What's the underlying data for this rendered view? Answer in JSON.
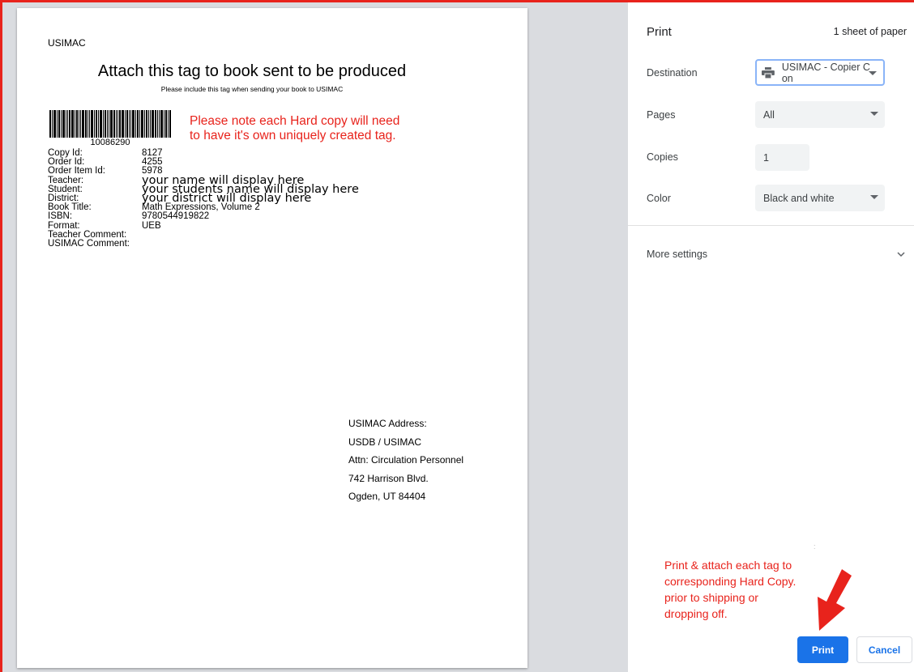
{
  "page": {
    "org": "USIMAC",
    "title": "Attach this tag to book sent to be produced",
    "subtitle": "Please include this tag when sending your book to USIMAC",
    "barcode_number": "10086290",
    "note_top_line1": "Please note each Hard copy will need",
    "note_top_line2": "to have it's own uniquely created tag.",
    "fields": [
      {
        "label": "Copy Id:",
        "value": "8127"
      },
      {
        "label": "Order Id:",
        "value": "4255"
      },
      {
        "label": "Order Item Id:",
        "value": "5978"
      },
      {
        "label": "Teacher:",
        "value": "your name will display here"
      },
      {
        "label": "Student:",
        "value": "your students name will display here"
      },
      {
        "label": "District:",
        "value": "your district will display here"
      },
      {
        "label": "Book Title:",
        "value": "Math Expressions, Volume 2"
      },
      {
        "label": "ISBN:",
        "value": "9780544919822"
      },
      {
        "label": "Format:",
        "value": "UEB"
      },
      {
        "label": "Teacher Comment:",
        "value": ""
      },
      {
        "label": "USIMAC Comment:",
        "value": ""
      }
    ],
    "address": [
      "USIMAC Address:",
      "USDB / USIMAC",
      "Attn: Circulation Personnel",
      "742 Harrison Blvd.",
      "Ogden, UT 84404"
    ]
  },
  "panel": {
    "title": "Print",
    "sheets": "1 sheet of paper",
    "destination_label": "Destination",
    "destination_value": "USIMAC - Copier C on",
    "pages_label": "Pages",
    "pages_value": "All",
    "copies_label": "Copies",
    "copies_value": "1",
    "color_label": "Color",
    "color_value": "Black and white",
    "more_settings": "More settings",
    "note_bottom": [
      "Print & attach each tag to",
      "corresponding Hard Copy.",
      "prior to shipping or",
      "dropping off."
    ],
    "print_button": "Print",
    "cancel_button": "Cancel"
  },
  "colors": {
    "annotation_red": "#e8231c",
    "primary_blue": "#1a73e8"
  }
}
